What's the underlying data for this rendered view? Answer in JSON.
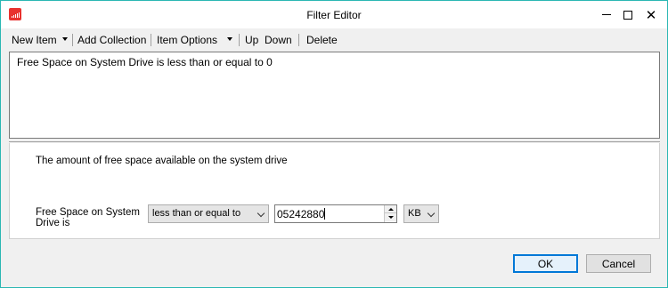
{
  "window": {
    "title": "Filter Editor",
    "accent_color": "#2bb7b3",
    "app_icon": "bar-chart-icon"
  },
  "toolbar": {
    "new_item": "New Item",
    "add_collection": "Add Collection",
    "item_options": "Item Options",
    "up": "Up",
    "down": "Down",
    "delete": "Delete"
  },
  "filter_list": {
    "lines": [
      "Free Space on System Drive is less than or equal to 0"
    ]
  },
  "detail": {
    "description": "The amount of free space available on the system drive",
    "field_label": "Free Space on System Drive is",
    "operator": "less than or equal to",
    "value": "05242880",
    "unit": "KB"
  },
  "buttons": {
    "ok": "OK",
    "cancel": "Cancel"
  }
}
